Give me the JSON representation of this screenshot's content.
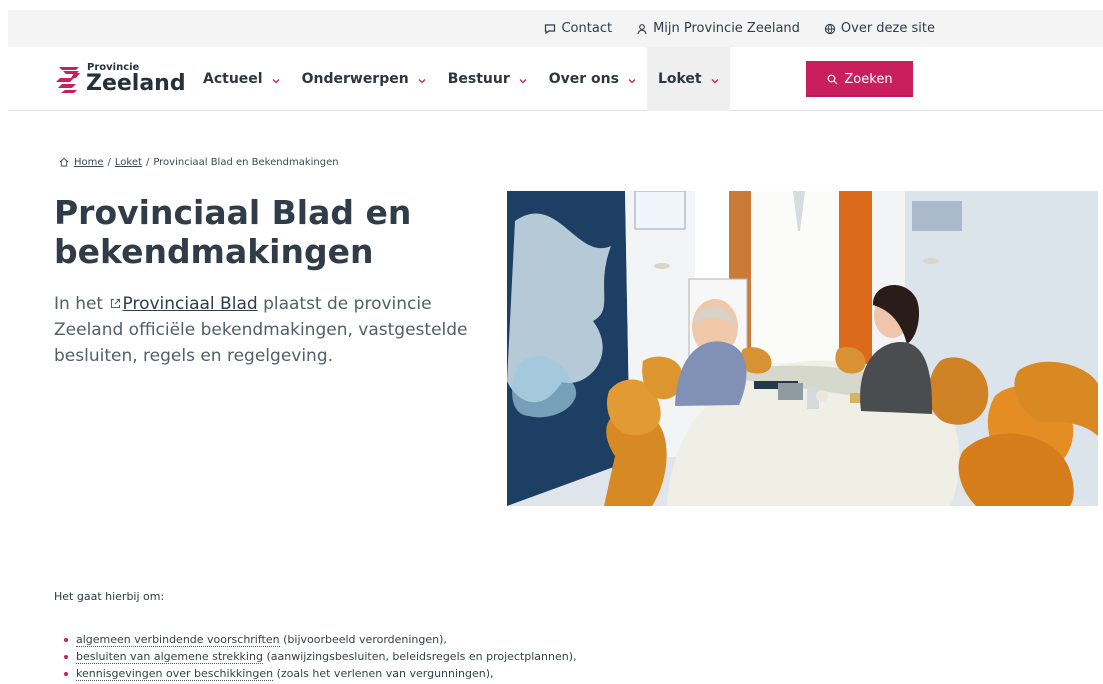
{
  "colors": {
    "accent": "#c91f5d",
    "text_dark": "#303c48",
    "text_muted": "#555d66",
    "top_bar": "#f4f4f4"
  },
  "topbar": {
    "links": [
      {
        "label": "Contact",
        "icon": "chat-bubble-icon"
      },
      {
        "label": "Mijn Provincie Zeeland",
        "icon": "user-icon"
      },
      {
        "label": "Over deze site",
        "icon": "globe-icon"
      }
    ]
  },
  "brand": {
    "small": "Provincie",
    "big": "Zeeland",
    "icon": "provincie-zeeland-logo"
  },
  "nav": {
    "items": [
      {
        "label": "Actueel",
        "active": false
      },
      {
        "label": "Onderwerpen",
        "active": false
      },
      {
        "label": "Bestuur",
        "active": false
      },
      {
        "label": "Over ons",
        "active": false
      },
      {
        "label": "Loket",
        "active": true
      }
    ],
    "search_label": "Zoeken",
    "search_icon": "search-icon"
  },
  "breadcrumb": {
    "home": "Home",
    "separator_1": "/",
    "loket": "Loket",
    "separator_2": "/",
    "current": "Provinciaal Blad en Bekendmakingen"
  },
  "page": {
    "title": "Provinciaal Blad en bekendmakingen",
    "intro_start": "In het",
    "intro_link": "Provinciaal Blad",
    "intro_end": "plaatst de provincie Zeeland officiële bekendmakingen, vastgestelde besluiten, regels en regelgeving.",
    "list_intro": "Het gaat hierbij om:",
    "items": [
      {
        "term": "algemeen verbindende voorschriften",
        "detail": "(bijvoorbeeld verordeningen),"
      },
      {
        "term": "besluiten van algemene strekking",
        "detail": "(aanwijzingsbesluiten, beleidsregels en projectplannen),"
      },
      {
        "term": "kennisgevingen over beschikkingen",
        "detail": "(zoals het verlenen van vergunningen),"
      }
    ]
  }
}
